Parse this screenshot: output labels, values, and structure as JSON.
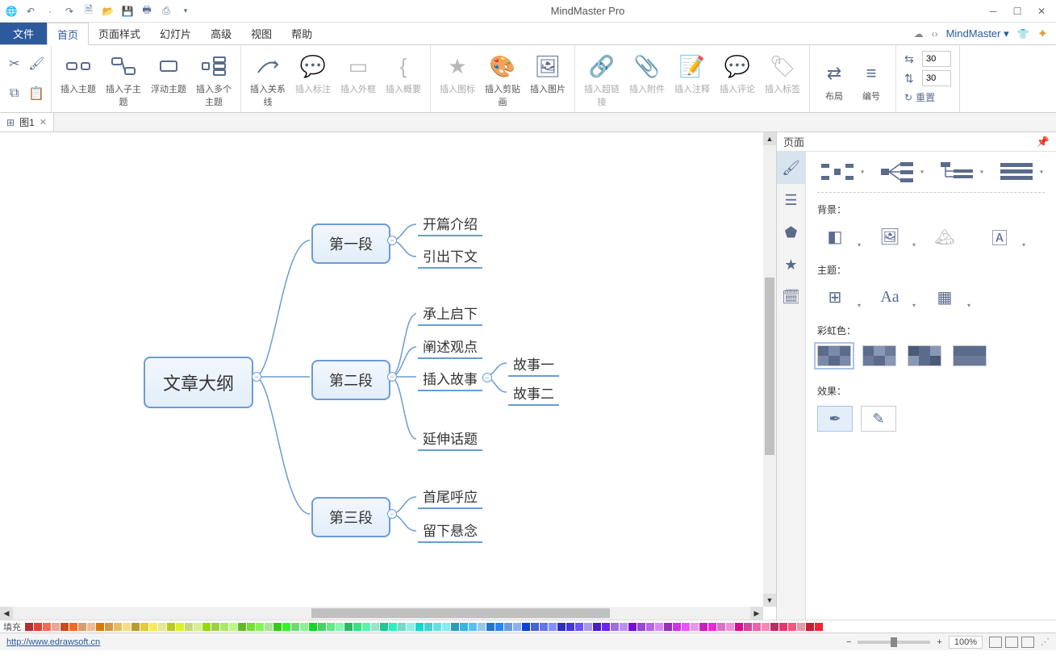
{
  "app": {
    "title": "MindMaster Pro"
  },
  "qat": [
    "globe-icon",
    "undo-icon",
    "redo-icon",
    "new-icon",
    "open-icon",
    "save-icon",
    "print-icon",
    "export-icon",
    "more-icon"
  ],
  "menu": {
    "file": "文件",
    "tabs": [
      "首页",
      "页面样式",
      "幻灯片",
      "高级",
      "视图",
      "帮助"
    ],
    "active": 0,
    "brand": "MindMaster"
  },
  "ribbon": {
    "clipboard": [
      "cut-icon",
      "format-paint-icon",
      "copy-icon",
      "paste-icon"
    ],
    "insert_topic": [
      {
        "key": "insert-topic",
        "label": "插入主题"
      },
      {
        "key": "insert-subtopic",
        "label": "插入子主题"
      },
      {
        "key": "floating-topic",
        "label": "浮动主题"
      },
      {
        "key": "insert-multi-topic",
        "label": "插入多个主题"
      }
    ],
    "insert_rel": [
      {
        "key": "insert-relation",
        "label": "插入关系线",
        "enabled": true
      },
      {
        "key": "insert-callout",
        "label": "插入标注",
        "enabled": false
      },
      {
        "key": "insert-boundary",
        "label": "插入外框",
        "enabled": false
      },
      {
        "key": "insert-summary",
        "label": "插入概要",
        "enabled": false
      }
    ],
    "insert_media": [
      {
        "key": "insert-icon",
        "label": "插入图标",
        "enabled": false
      },
      {
        "key": "insert-clipart",
        "label": "插入剪贴画",
        "enabled": true
      },
      {
        "key": "insert-image",
        "label": "插入图片",
        "enabled": true
      }
    ],
    "insert_attach": [
      {
        "key": "insert-link",
        "label": "插入超链接",
        "enabled": false
      },
      {
        "key": "insert-attachment",
        "label": "插入附件",
        "enabled": false
      },
      {
        "key": "insert-note",
        "label": "插入注释",
        "enabled": false
      },
      {
        "key": "insert-comment",
        "label": "插入评论",
        "enabled": false
      },
      {
        "key": "insert-tag",
        "label": "插入标签",
        "enabled": false
      }
    ],
    "layout": [
      {
        "key": "layout",
        "label": "布局"
      },
      {
        "key": "number",
        "label": "编号"
      }
    ],
    "spacing": {
      "h": "30",
      "v": "30",
      "reset": "重置"
    }
  },
  "doctab": {
    "name": "图1"
  },
  "mindmap": {
    "root": "文章大纲",
    "sections": [
      {
        "title": "第一段",
        "leaves": [
          "开篇介绍",
          "引出下文"
        ]
      },
      {
        "title": "第二段",
        "leaves": [
          "承上启下",
          "阐述观点",
          "插入故事",
          "延伸话题"
        ],
        "sub": {
          "parent_index": 2,
          "leaves": [
            "故事一",
            "故事二"
          ]
        }
      },
      {
        "title": "第三段",
        "leaves": [
          "首尾呼应",
          "留下悬念"
        ]
      }
    ]
  },
  "sidepanel": {
    "title": "页面",
    "sections": {
      "background": "背景：",
      "theme": "主题：",
      "rainbow": "彩虹色：",
      "effect": "效果："
    }
  },
  "status": {
    "fill_label": "填充",
    "url": "http://www.edrawsoft.cn",
    "zoom": "100%"
  }
}
